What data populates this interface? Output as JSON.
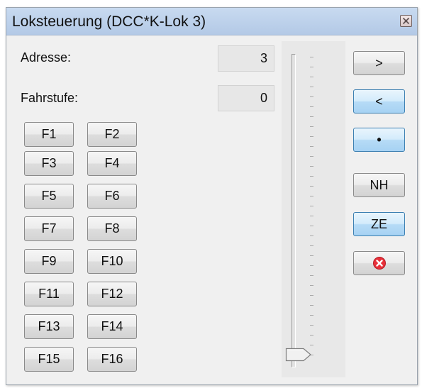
{
  "window": {
    "title": "Loksteuerung (DCC*K-Lok 3)",
    "close_icon": "close-x-icon"
  },
  "fields": {
    "address_label": "Adresse:",
    "address_value": "3",
    "speed_step_label": "Fahrstufe:",
    "speed_step_value": "0"
  },
  "function_buttons": [
    "F1",
    "F2",
    "F3",
    "F4",
    "F5",
    "F6",
    "F7",
    "F8",
    "F9",
    "F10",
    "F11",
    "F12",
    "F13",
    "F14",
    "F15",
    "F16"
  ],
  "controls": {
    "forward": ">",
    "backward": "<",
    "stop": "•",
    "nh": "NH",
    "ze": "ZE",
    "emergency_icon": "red-circle-x-icon"
  },
  "speed_slider": {
    "level": 0
  },
  "colors": {
    "blue_button": "#b6dbf6",
    "emergency_red": "#e8303a",
    "title_bar": "#c1d5ee"
  }
}
